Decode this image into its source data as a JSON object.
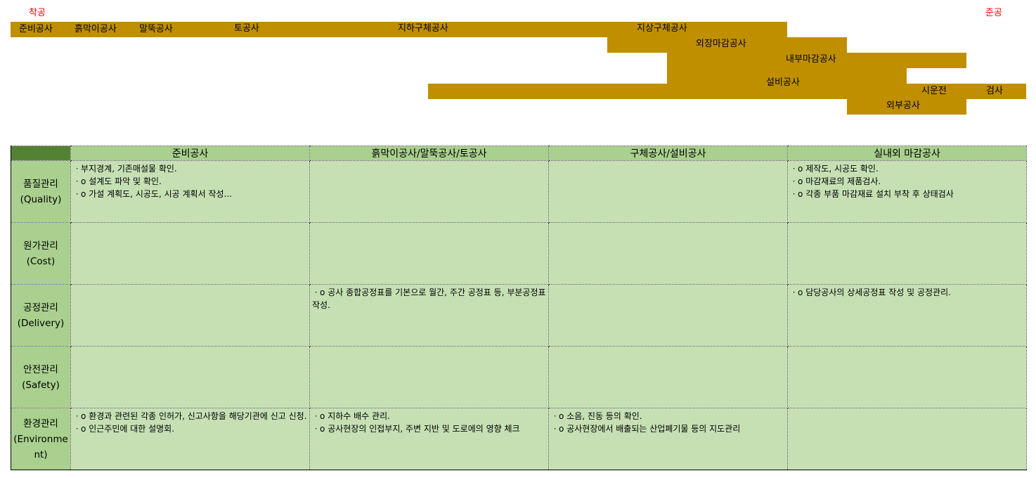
{
  "milestones": {
    "start": "착공",
    "end": "준공"
  },
  "colors": {
    "bar": "#bf8f00",
    "header": "#a9d08e",
    "corner": "#548235",
    "cell": "#c6e0b4",
    "milestone": "#ff0000"
  },
  "schedule": {
    "prep": "준비공사",
    "earth_retaining": "흙막이공사",
    "piling": "말뚝공사",
    "earthwork": "토공사",
    "underground": "지하구체공사",
    "above_ground": "지상구체공사",
    "exterior_finish": "외장마감공사",
    "interior_finish": "내부마감공사",
    "mep": "설비공사",
    "commissioning": "시운전",
    "inspection": "검사",
    "external_works": "외부공사"
  },
  "matrix": {
    "columns": [
      "준비공사",
      "흙막이공사/말뚝공사/토공사",
      "구체공사/설비공사",
      "실내외 마감공사"
    ],
    "rows": [
      {
        "label": "품질관리",
        "sub": "(Quality)",
        "cells": [
          [
            "ㆍ부지경계, 기존매설물 확인.",
            "ㆍo 설계도 파악 및 확인.",
            "ㆍo 가설 계획도, 시공도, 시공 계획서 작성..."
          ],
          [],
          [],
          [
            "ㆍo 제작도, 시공도 확인.",
            "ㆍo 마감재료의 제품검사.",
            "ㆍo 각종 부품 마감재료 설치 부착 후 상태검사"
          ]
        ]
      },
      {
        "label": "원가관리",
        "sub": "(Cost)",
        "cells": [
          [],
          [],
          [],
          []
        ]
      },
      {
        "label": "공정관리",
        "sub": "(Delivery)",
        "cells": [
          [],
          [
            "ㆍo 공사 종합공정표를 기본으로 월간, 주간 공정표 등, 부분공정표 작성."
          ],
          [],
          [
            "ㆍo 담당공사의 상세공정표 작성 및 공정관리."
          ]
        ]
      },
      {
        "label": "안전관리",
        "sub": "(Safety)",
        "cells": [
          [],
          [],
          [],
          []
        ]
      },
      {
        "label": "환경관리",
        "sub": "(Environment)",
        "cells": [
          [
            "ㆍo  환경과 관련된 각종 인허가, 신고사항을 해당기관에 신고 신청.",
            "ㆍo 인근주민에 대한 설명회."
          ],
          [
            "ㆍo 지하수 배수 관리.",
            "ㆍo 공사현장의 인접부지, 주변 지반 및 도로에의 영향 체크"
          ],
          [
            "ㆍo 소음, 진동 등의 확인.",
            "ㆍo 공사현장에서 배출되는 산업폐기물 등의 지도관리"
          ],
          []
        ]
      }
    ]
  }
}
